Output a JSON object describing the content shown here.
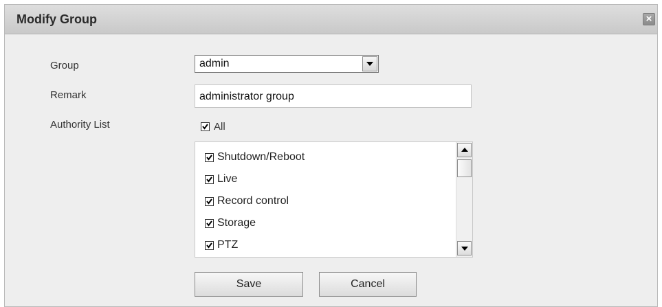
{
  "dialog": {
    "title": "Modify Group",
    "close_symbol": "×"
  },
  "form": {
    "group_label": "Group",
    "group_value": "admin",
    "remark_label": "Remark",
    "remark_value": "administrator group",
    "authority_label": "Authority List",
    "all_label": "All",
    "all_checked": true
  },
  "authorities": [
    {
      "label": "Shutdown/Reboot",
      "checked": true
    },
    {
      "label": "Live",
      "checked": true
    },
    {
      "label": "Record control",
      "checked": true
    },
    {
      "label": "Storage",
      "checked": true
    },
    {
      "label": "PTZ",
      "checked": true
    }
  ],
  "buttons": {
    "save": "Save",
    "cancel": "Cancel"
  },
  "icons": {
    "close": "close-icon",
    "dropdown": "chevron-down-icon",
    "check": "checkmark-icon",
    "scroll_up": "scroll-up-arrow-icon",
    "scroll_down": "scroll-down-arrow-icon"
  }
}
